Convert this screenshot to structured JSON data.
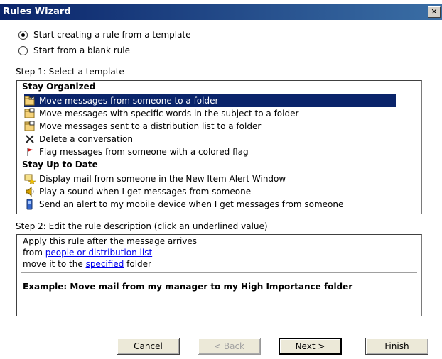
{
  "window": {
    "title": "Rules Wizard",
    "close_glyph": "✕"
  },
  "options": [
    {
      "label": "Start creating a rule from a template",
      "checked": true
    },
    {
      "label": "Start from a blank rule",
      "checked": false
    }
  ],
  "step1": {
    "label": "Step 1: Select a template",
    "groups": [
      {
        "name": "Stay Organized",
        "items": [
          {
            "label": "Move messages from someone to a folder",
            "icon": "move-folder-icon",
            "selected": true
          },
          {
            "label": "Move messages with specific words in the subject to a folder",
            "icon": "move-folder-icon",
            "selected": false
          },
          {
            "label": "Move messages sent to a distribution list to a folder",
            "icon": "move-folder-icon",
            "selected": false
          },
          {
            "label": "Delete a conversation",
            "icon": "delete-x-icon",
            "selected": false
          },
          {
            "label": "Flag messages from someone with a colored flag",
            "icon": "flag-icon",
            "selected": false
          }
        ]
      },
      {
        "name": "Stay Up to Date",
        "items": [
          {
            "label": "Display mail from someone in the New Item Alert Window",
            "icon": "alert-window-icon",
            "selected": false
          },
          {
            "label": "Play a sound when I get messages from someone",
            "icon": "sound-icon",
            "selected": false
          },
          {
            "label": "Send an alert to my mobile device when I get messages from someone",
            "icon": "mobile-device-icon",
            "selected": false
          }
        ]
      }
    ]
  },
  "step2": {
    "label": "Step 2: Edit the rule description (click an underlined value)",
    "line1": "Apply this rule after the message arrives",
    "line2_prefix": "from ",
    "line2_link": "people or distribution list",
    "line3_prefix": "move it to the ",
    "line3_link": "specified",
    "line3_suffix": " folder",
    "example": "Example: Move mail from my manager to my High Importance folder"
  },
  "buttons": {
    "cancel": "Cancel",
    "back": "< Back",
    "next": "Next >",
    "finish": "Finish"
  },
  "colors": {
    "selection": "#0a246a",
    "link": "#0000ee",
    "titlebar": "#0a246a"
  }
}
